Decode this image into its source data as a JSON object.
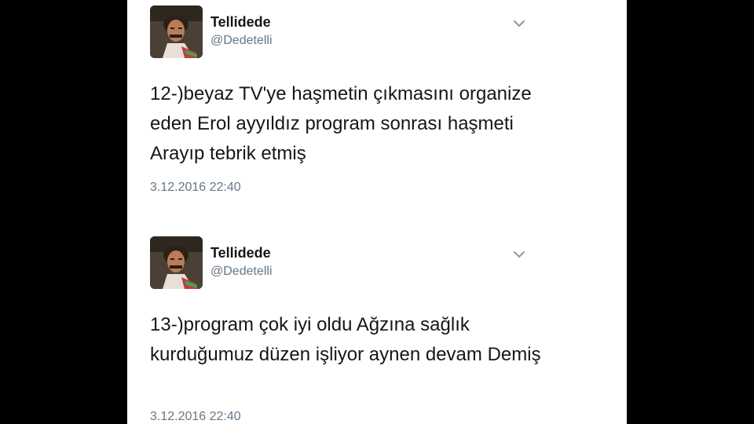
{
  "tweets": [
    {
      "display_name": "Tellidede",
      "handle": "@Dedetelli",
      "text": "12-)beyaz TV'ye haşmetin çıkmasını organize eden Erol ayyıldız program sonrası haşmeti Arayıp tebrik etmiş",
      "timestamp": "3.12.2016 22:40",
      "menu_icon": "chevron-down-icon"
    },
    {
      "display_name": "Tellidede",
      "handle": "@Dedetelli",
      "text": "13-)program çok iyi oldu Ağzına sağlık kurduğumuz düzen işliyor aynen devam Demiş",
      "timestamp": "3.12.2016 22:40",
      "menu_icon": "chevron-down-icon"
    }
  ],
  "colors": {
    "background": "#000000",
    "panel": "#ffffff",
    "text_primary": "#14171a",
    "text_secondary": "#657786",
    "chevron": "#8899a6"
  }
}
